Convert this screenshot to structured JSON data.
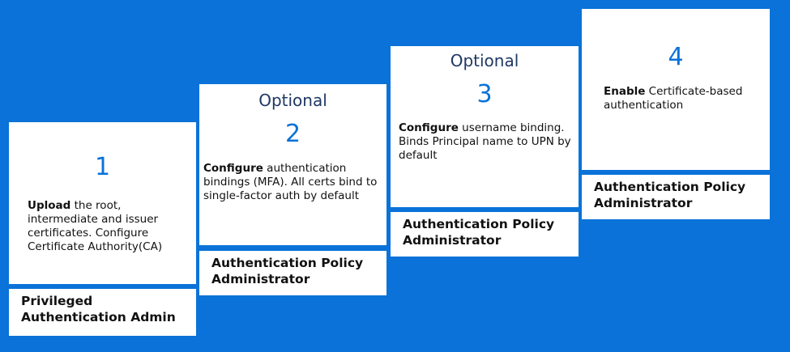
{
  "steps": [
    {
      "number": "1",
      "optional": "",
      "action": "Upload",
      "text": " the root, intermediate and issuer certificates. Configure Certificate Authority(CA)",
      "role": "Privileged Authentication Admin"
    },
    {
      "number": "2",
      "optional": "Optional",
      "action": "Configure",
      "text": "  authentication bindings (MFA). All certs bind to single-factor auth by default",
      "role": "Authentication Policy Administrator"
    },
    {
      "number": "3",
      "optional": "Optional",
      "action": "Configure",
      "text": " username binding. Binds Principal name to UPN by default",
      "role": "Authentication Policy Administrator"
    },
    {
      "number": "4",
      "optional": "",
      "action": "Enable",
      "text": " Certificate-based authentication",
      "role": "Authentication Policy Administrator"
    }
  ],
  "colors": {
    "background": "#0a72d8",
    "number": "#0a72d8",
    "optional": "#1f3864"
  }
}
